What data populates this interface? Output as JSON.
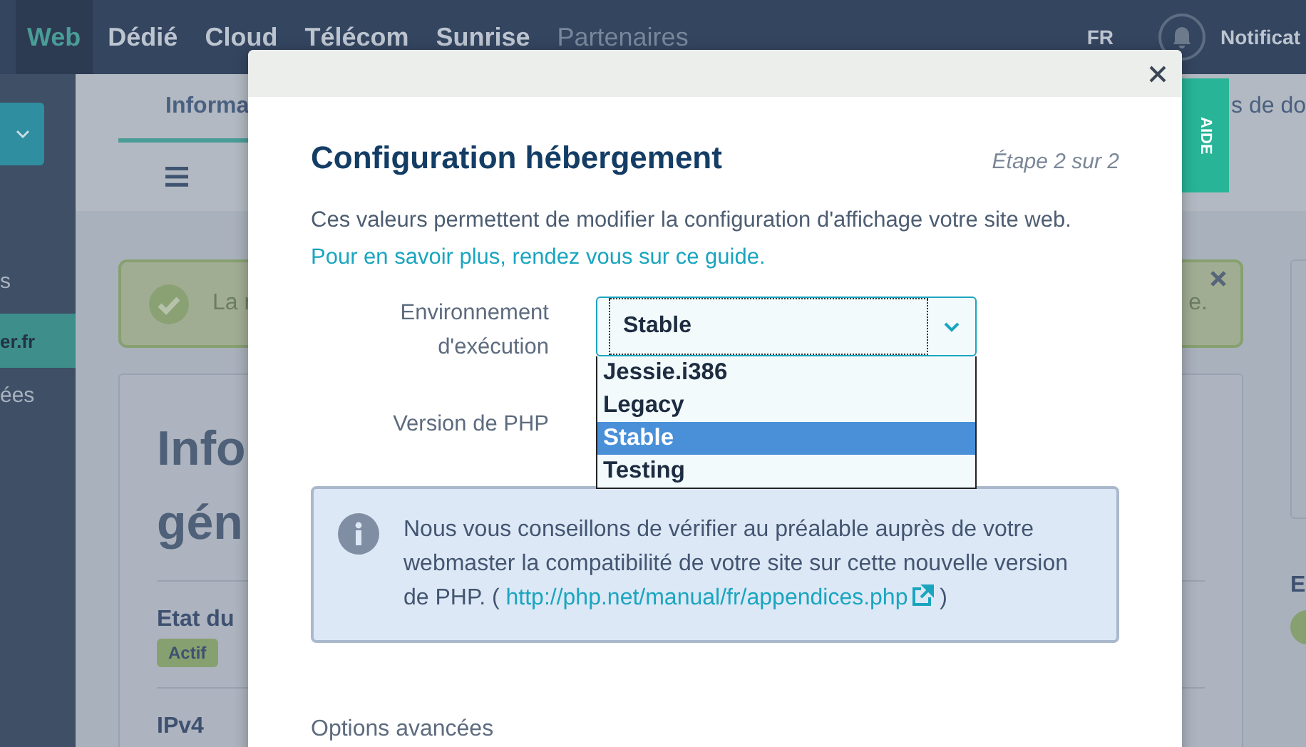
{
  "nav": {
    "items": [
      {
        "label": "Web",
        "selected": true,
        "disabled": false
      },
      {
        "label": "Dédié",
        "selected": false,
        "disabled": false
      },
      {
        "label": "Cloud",
        "selected": false,
        "disabled": false
      },
      {
        "label": "Télécom",
        "selected": false,
        "disabled": false
      },
      {
        "label": "Sunrise",
        "selected": false,
        "disabled": false
      },
      {
        "label": "Partenaires",
        "selected": false,
        "disabled": true
      }
    ],
    "language": "FR",
    "notifications_label": "Notificat"
  },
  "sidebar": {
    "items": [
      {
        "label": "s",
        "selected": false
      },
      {
        "label": "er.fr",
        "selected": true
      },
      {
        "label": "ées",
        "selected": false
      }
    ]
  },
  "subnav": {
    "tabs": [
      {
        "label": "Informa",
        "selected": true
      },
      {
        "label": "s de do",
        "selected": false
      }
    ]
  },
  "alert": {
    "text_start": "La r",
    "text_end": "e."
  },
  "card": {
    "title_lines": [
      "Info",
      "gén"
    ],
    "status_label": "Etat du",
    "status_badge": "Actif",
    "ipv4_label": "IPv4"
  },
  "side_card": {
    "label": "E",
    "toggle_on": true
  },
  "help_tab": "AIDE",
  "modal": {
    "title": "Configuration hébergement",
    "step": "Étape 2 sur 2",
    "intro": "Ces valeurs permettent de modifier la configuration d'affichage votre site web.",
    "intro_link": "Pour en savoir plus, rendez vous sur ce guide.",
    "fields": [
      {
        "label": "Environnement d'exécution",
        "value": "Stable",
        "open": true,
        "options": [
          {
            "label": "Jessie.i386",
            "selected": false
          },
          {
            "label": "Legacy",
            "selected": false
          },
          {
            "label": "Stable",
            "selected": true
          },
          {
            "label": "Testing",
            "selected": false
          }
        ]
      },
      {
        "label": "Version de PHP"
      }
    ],
    "info": {
      "text": "Nous vous conseillons de vérifier au préalable auprès de votre webmaster la compatibilité de votre site sur cette nouvelle version de PHP. (",
      "link": "http://php.net/manual/fr/appendices.php",
      "text_after": ")"
    },
    "advanced_label": "Options avancées"
  }
}
